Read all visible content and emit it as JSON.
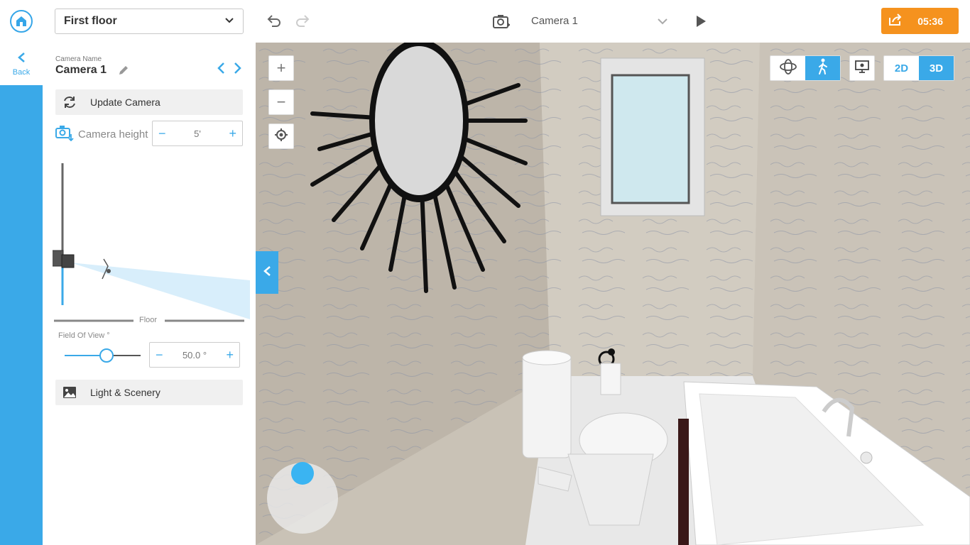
{
  "top_bar": {
    "floor_select_value": "First floor",
    "camera_title": "Camera 1",
    "share_time": "05:36"
  },
  "rail": {
    "back_label": "Back"
  },
  "panel": {
    "camera_name_caption": "Camera Name",
    "camera_name": "Camera 1",
    "update_camera_label": "Update Camera",
    "camera_height_label": "Camera height",
    "camera_height_value": "5'",
    "stepper_minus": "−",
    "stepper_plus": "+",
    "floor_label": "Floor",
    "fov_label": "Field Of View °",
    "fov_value": "50.0 °",
    "fov_slider_fraction": 0.55,
    "light_scenery_label": "Light & Scenery"
  },
  "viewport": {
    "zoom_in_label": "+",
    "zoom_out_label": "−",
    "mode_2d_label": "2D",
    "mode_3d_label": "3D",
    "active_mode": "3D",
    "active_navigation": "walk"
  },
  "icons": {
    "logo": "home-logo-icon",
    "chevron": "chevron-down-icon",
    "undo": "undo-icon",
    "redo": "redo-icon",
    "camera_add": "camera-add-icon",
    "play": "play-icon",
    "share": "share-icon",
    "back": "chevron-left-icon",
    "pencil": "pencil-icon",
    "refresh": "refresh-icon",
    "camera_height": "camera-height-icon",
    "image": "image-icon",
    "target": "locate-icon",
    "orbit": "orbit-icon",
    "walk": "walk-icon",
    "screen": "screen-icon"
  },
  "colors": {
    "accent": "#3aa9e8",
    "share_orange": "#f5921e",
    "wall": "#c9c2b6"
  }
}
